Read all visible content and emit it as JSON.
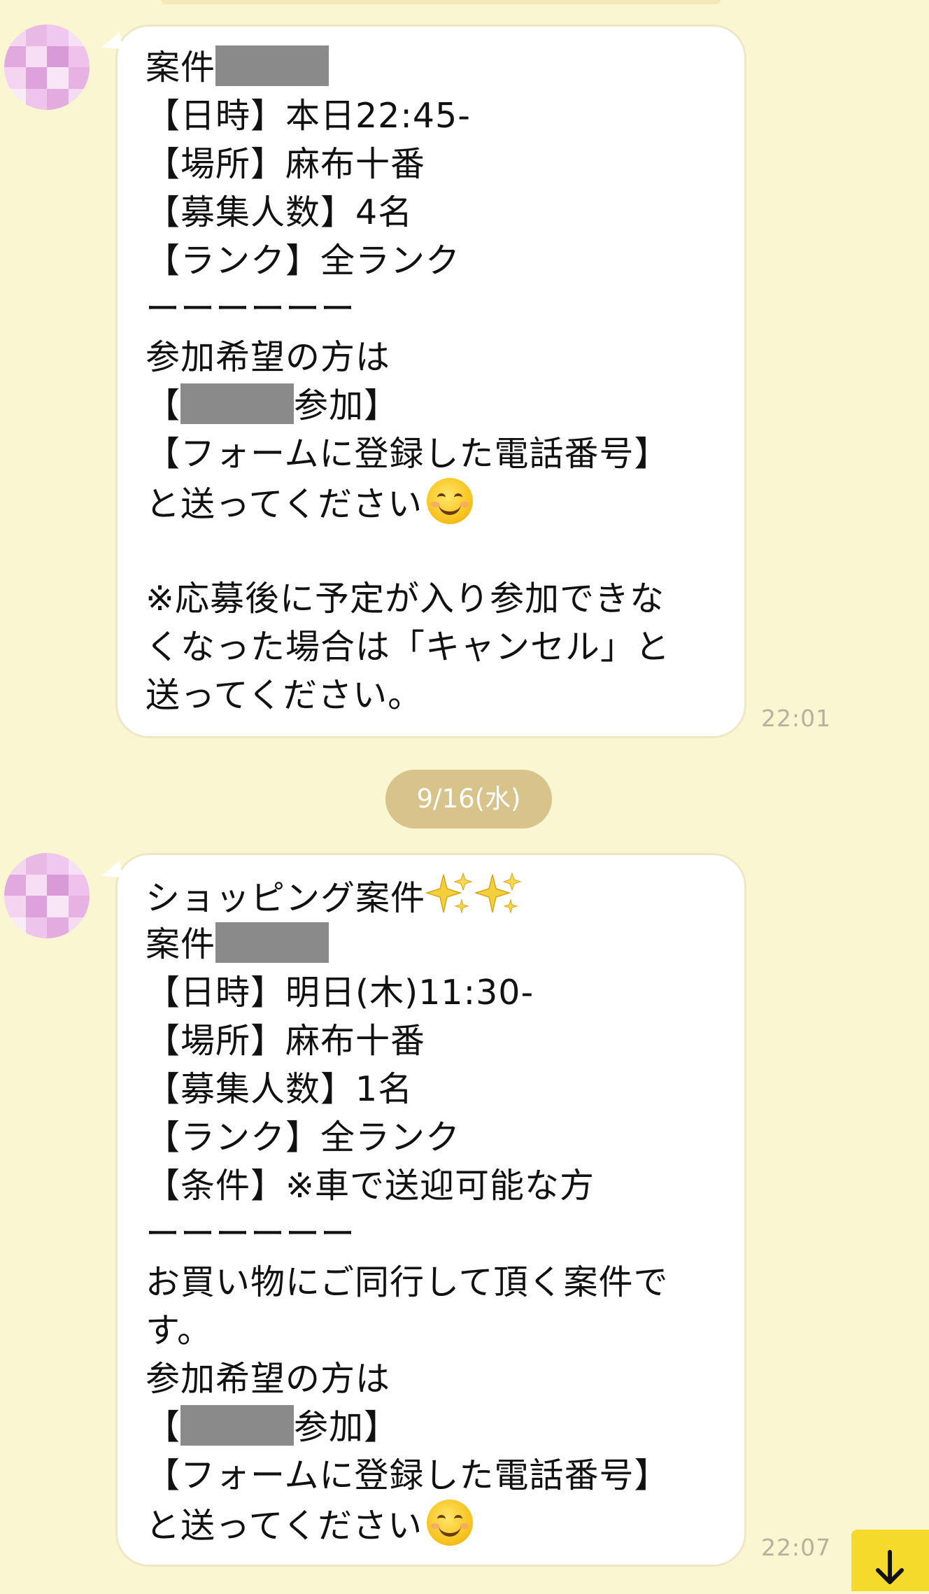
{
  "messages": [
    {
      "lines": [
        {
          "text": "案件",
          "redact_width": 162
        },
        {
          "text": "【日時】本日22:45-"
        },
        {
          "text": "【場所】麻布十番"
        },
        {
          "text": "【募集人数】4名"
        },
        {
          "text": "【ランク】全ランク"
        },
        {
          "text": "ーーーーーー"
        },
        {
          "text": "参加希望の方は"
        },
        {
          "prefix": "【",
          "suffix": "参加】",
          "redact_width": 162
        },
        {
          "text": "【フォームに登録した電話番号】"
        },
        {
          "text": "と送ってください",
          "emoji": "smiling-face-icon"
        },
        {
          "text": ""
        },
        {
          "text": "※応募後に予定が入り参加できな"
        },
        {
          "text": "くなった場合は「キャンセル」と"
        },
        {
          "text": "送ってください。"
        }
      ],
      "time": "22:01"
    },
    {
      "lines": [
        {
          "text": "ショッピング案件",
          "emoji": "sparkles-icon",
          "emoji_count": 2
        },
        {
          "text": "案件",
          "redact_width": 162
        },
        {
          "text": "【日時】明日(木)11:30-"
        },
        {
          "text": "【場所】麻布十番"
        },
        {
          "text": "【募集人数】1名"
        },
        {
          "text": "【ランク】全ランク"
        },
        {
          "text": "【条件】※車で送迎可能な方"
        },
        {
          "text": "ーーーーーー"
        },
        {
          "text": "お買い物にご同行して頂く案件で"
        },
        {
          "text": "す。"
        },
        {
          "text": "参加希望の方は"
        },
        {
          "prefix": "【",
          "suffix": "参加】",
          "redact_width": 162
        },
        {
          "text": "【フォームに登録した電話番号】"
        },
        {
          "text": "と送ってください",
          "emoji": "smiling-face-icon"
        }
      ],
      "time": "22:07"
    }
  ],
  "date_separator": "9/16(水)",
  "colors": {
    "background": "#fbf6d2",
    "bubble": "#ffffff",
    "date_chip": "#d8c48b",
    "scroll_button": "#f6da2b",
    "redaction": "#8a8a8a"
  },
  "icons": {
    "scroll_button": "arrow-down-icon"
  }
}
